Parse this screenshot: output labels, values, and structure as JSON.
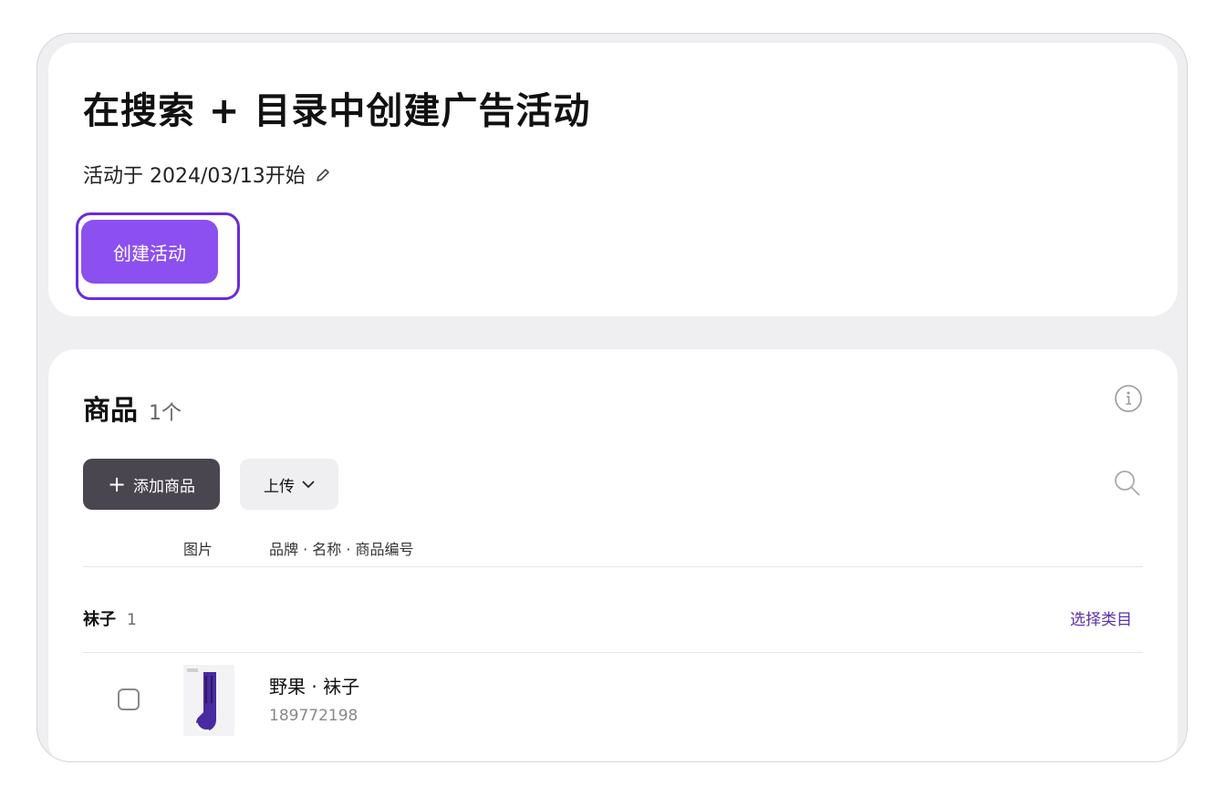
{
  "campaign": {
    "title": "在搜索 + 目录中创建广告活动",
    "start_text": "活动于 2024/03/13开始",
    "create_button": "创建活动"
  },
  "products": {
    "title": "商品",
    "count": "1个",
    "add_button": "添加商品",
    "upload_button": "上传",
    "columns": {
      "image": "图片",
      "info": "品牌 · 名称 · 商品编号"
    },
    "group": {
      "name": "袜子",
      "count": "1",
      "action": "选择类目"
    },
    "items": [
      {
        "name": "野果 · 袜子",
        "id": "189772198"
      }
    ]
  },
  "colors": {
    "accent": "#8b50ef",
    "highlight": "#6c2bd9",
    "dark_button": "#4a4650",
    "link": "#5a2fae"
  }
}
